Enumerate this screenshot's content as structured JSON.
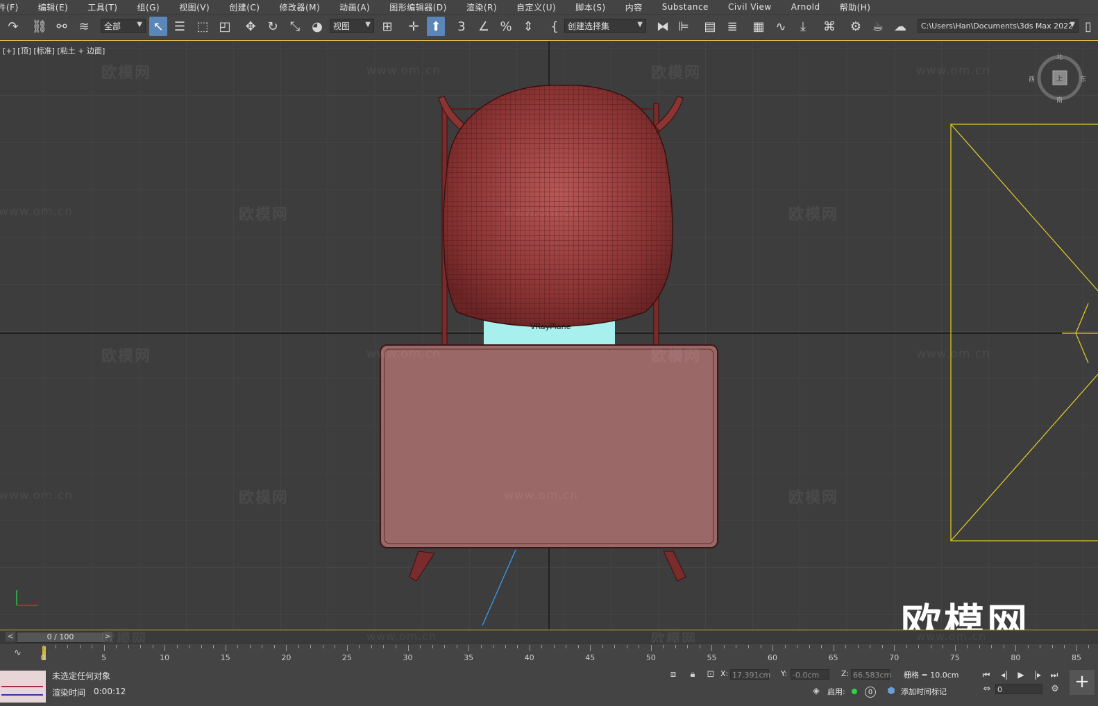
{
  "menu": [
    "文件(F)",
    "编辑(E)",
    "工具(T)",
    "组(G)",
    "视图(V)",
    "创建(C)",
    "修改器(M)",
    "动画(A)",
    "图形编辑器(D)",
    "渲染(R)",
    "自定义(U)",
    "脚本(S)",
    "内容",
    "Substance",
    "Civil View",
    "Arnold",
    "帮助(H)"
  ],
  "toolbar": {
    "selection_filter": "全部",
    "ref_coord": "视图",
    "named_selection": "创建选择集",
    "project_path": "C:\\Users\\Han\\Documents\\3ds Max 2022"
  },
  "viewport": {
    "label": "[+] [顶] [标准] [粘土 + 边面]",
    "object_label": "VRayPlane",
    "watermark_text": "欧模网",
    "watermark_url": "www.om.cn",
    "big_logo": "欧模网",
    "viewcube": {
      "top": "北",
      "bottom": "南",
      "left": "西",
      "right": "东",
      "face": "上"
    }
  },
  "timeline": {
    "frame_display": "0 / 100",
    "prev": "<",
    "next": ">",
    "ticks": [
      "0",
      "5",
      "10",
      "15",
      "20",
      "25",
      "30",
      "35",
      "40",
      "45",
      "50",
      "55",
      "60",
      "65",
      "70",
      "75",
      "80",
      "85"
    ]
  },
  "status": {
    "selection_msg": "未选定任何对象",
    "render_time_label": "渲染时间",
    "render_time_value": "0:00:12",
    "x_label": "X:",
    "x_value": "17.391cm",
    "y_label": "Y:",
    "y_value": "-0.0cm",
    "z_label": "Z:",
    "z_value": "66.583cm",
    "grid_label": "栅格 = 10.0cm",
    "enable_label": "启用:",
    "enable_value": "0",
    "add_time_tag": "添加时间标记",
    "frame_field": "0"
  },
  "colors": {
    "accent": "#5b86b8",
    "chair": "#8a3a3a",
    "table_top": "#9b6868",
    "plane": "#a8f0ee",
    "camera": "#e8d020",
    "viewport_bg": "#3d3d3d"
  }
}
